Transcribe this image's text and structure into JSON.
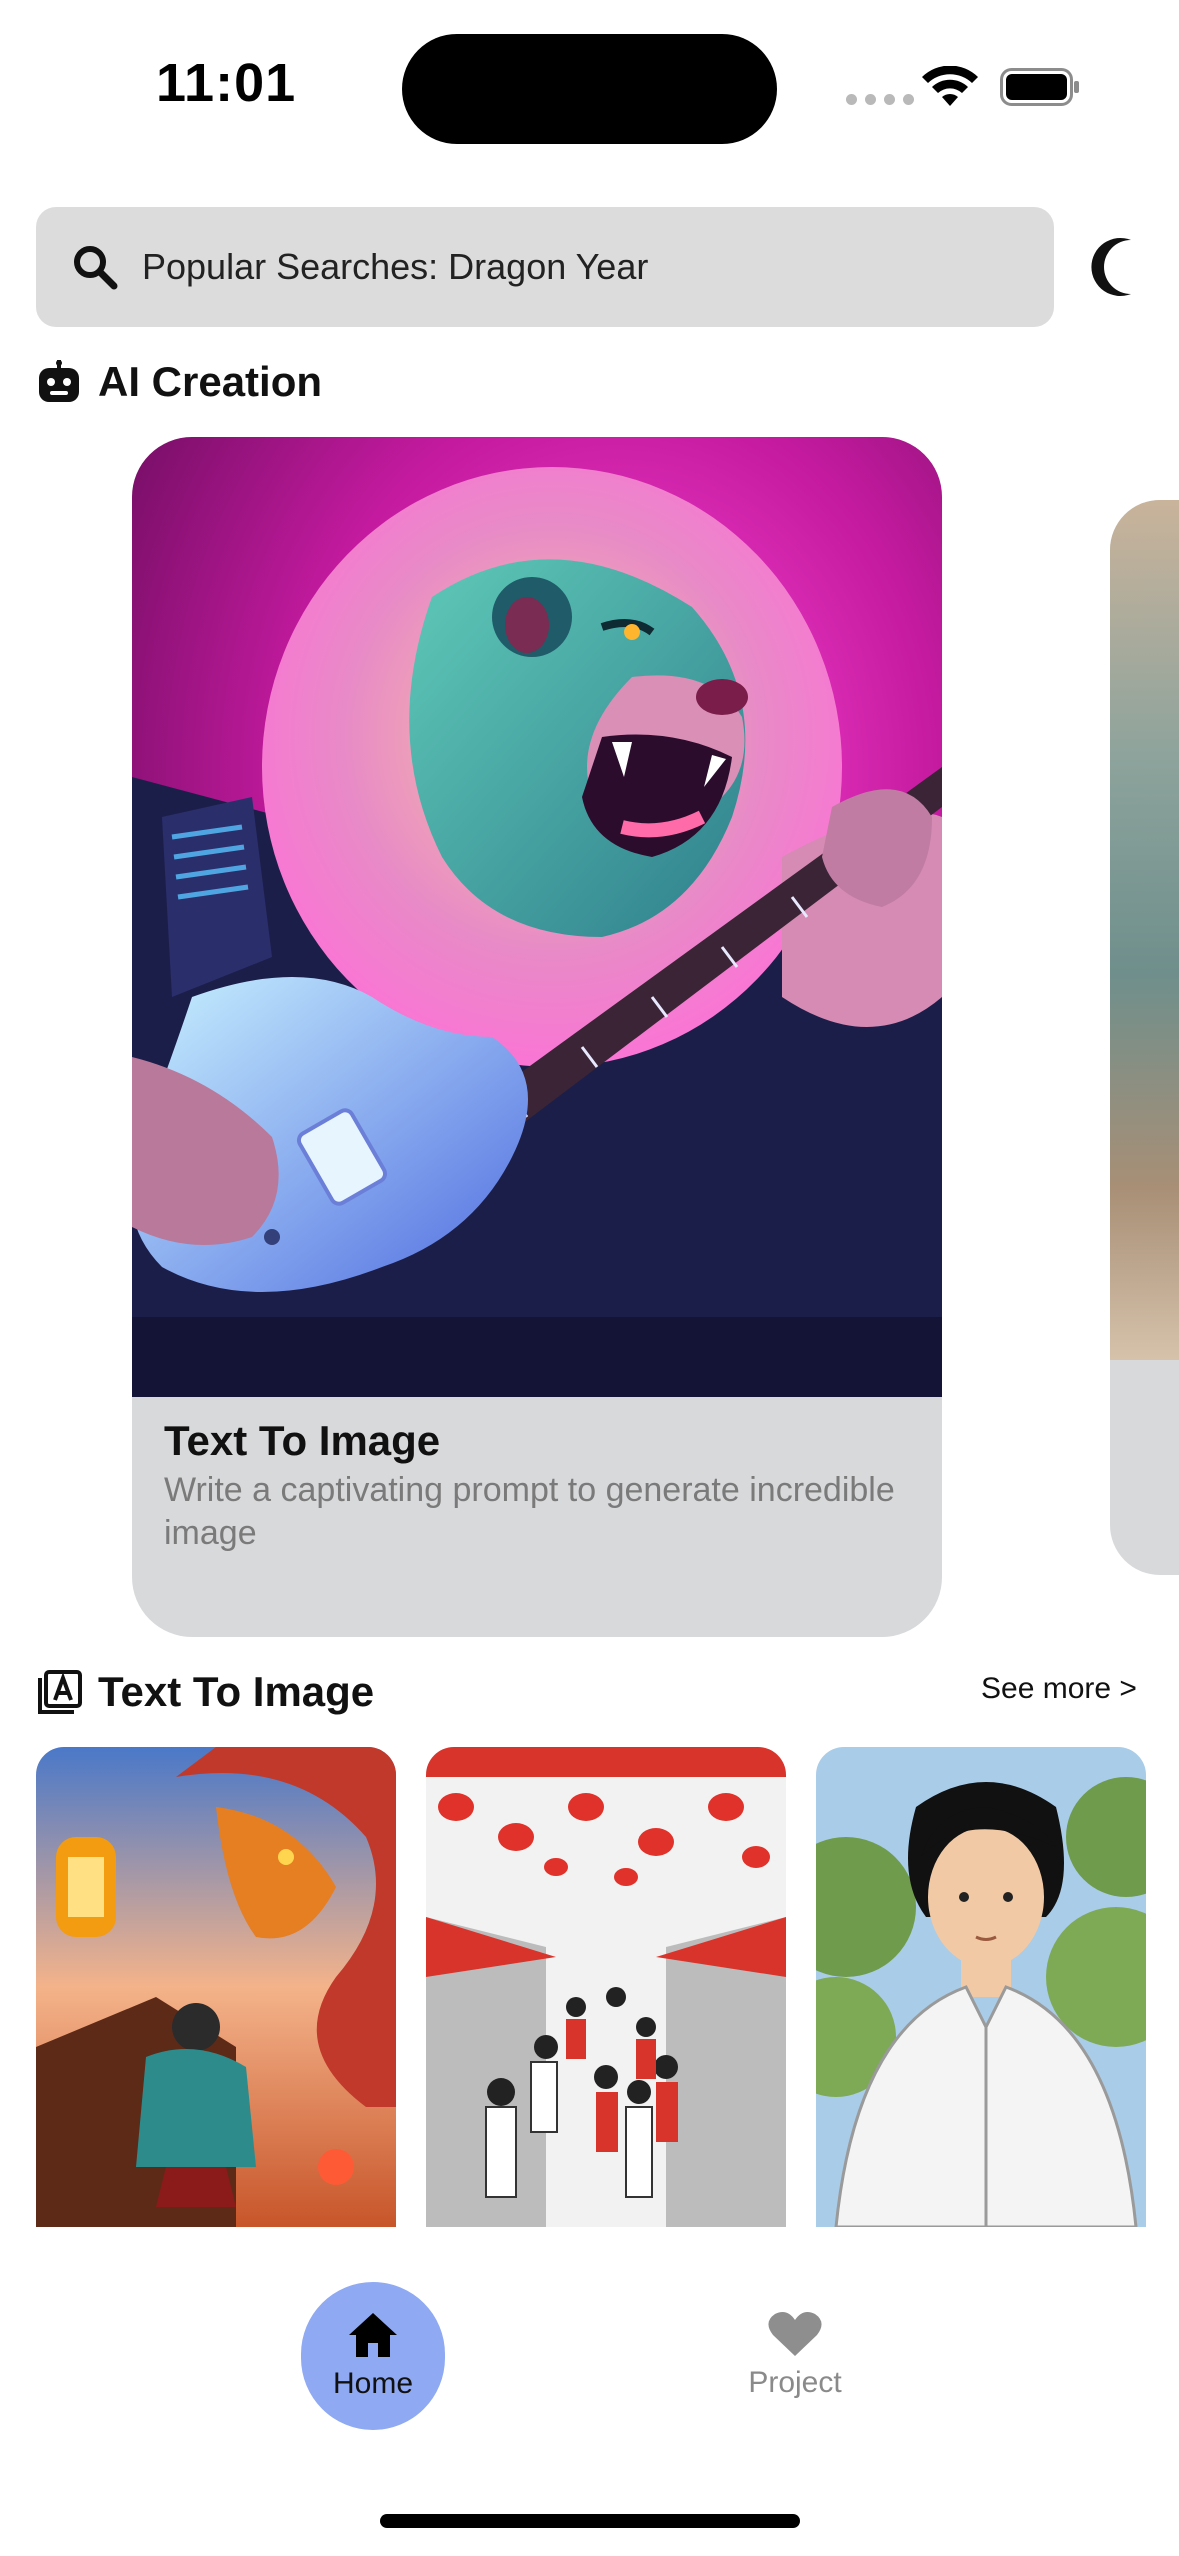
{
  "status_bar": {
    "time": "11:01"
  },
  "search": {
    "placeholder": "Popular Searches: Dragon Year"
  },
  "ai_creation": {
    "title": "AI Creation",
    "card": {
      "title": "Text To Image",
      "description": "Write a captivating prompt to generate incredible image"
    }
  },
  "text_to_image": {
    "title": "Text To Image",
    "see_more": "See more >"
  },
  "tab_bar": {
    "home_label": "Home",
    "project_label": "Project"
  },
  "colors": {
    "accent": "#8fa9f2",
    "card_bg": "#d8d9db",
    "search_bg": "#dcdcdd"
  },
  "icons": [
    "search-icon",
    "moon-icon",
    "robot-icon",
    "text-image-icon",
    "home-icon",
    "heart-icon",
    "wifi-icon",
    "battery-icon"
  ]
}
